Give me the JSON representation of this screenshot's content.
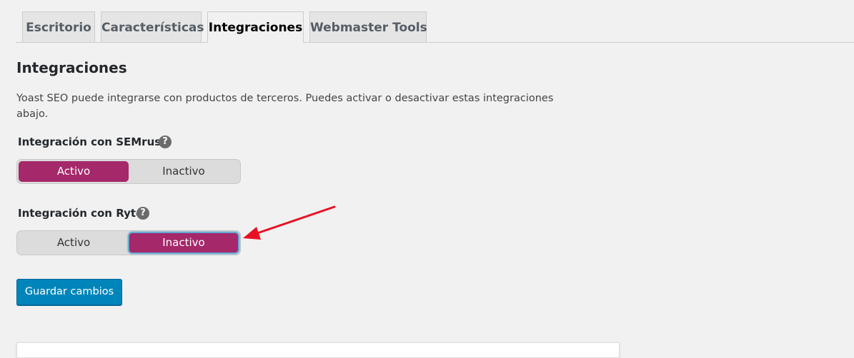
{
  "tabs": [
    {
      "label": "Escritorio",
      "active": false
    },
    {
      "label": "Características",
      "active": false
    },
    {
      "label": "Integraciones",
      "active": true
    },
    {
      "label": "Webmaster Tools",
      "active": false
    }
  ],
  "page": {
    "heading": "Integraciones",
    "description": "Yoast SEO puede integrarse con productos de terceros. Puedes activar o desactivar estas integraciones abajo."
  },
  "integrations": [
    {
      "label": "Integración con SEMrush",
      "help_icon": "?",
      "options": [
        "Activo",
        "Inactivo"
      ],
      "selected": "Activo"
    },
    {
      "label": "Integración con Ryte",
      "help_icon": "?",
      "options": [
        "Activo",
        "Inactivo"
      ],
      "selected": "Inactivo"
    }
  ],
  "save_button": {
    "label": "Guardar cambios"
  },
  "colors": {
    "toggle_active": "#a4286a",
    "primary_button": "#0085ba",
    "annotation_arrow": "#e81123"
  }
}
